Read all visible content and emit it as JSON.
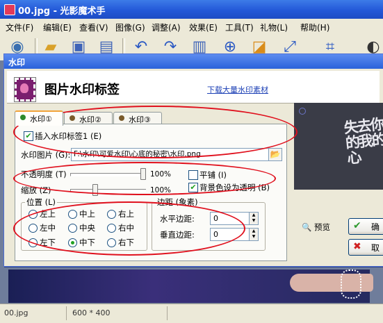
{
  "window": {
    "title": "00.jpg - 光影魔术手"
  },
  "menu": [
    "文件(F)",
    "编辑(E)",
    "查看(V)",
    "图像(G)",
    "调整(A)",
    "效果(E)",
    "工具(T)",
    "礼物(L)",
    "帮助(H)"
  ],
  "toolbar": {
    "icons": [
      "eye-icon",
      "open-folder-icon",
      "save-icon",
      "save-as-icon",
      "undo-icon",
      "redo-icon",
      "compare-icon",
      "zoom-icon",
      "auto-icon",
      "rotate-icon",
      "crop-icon",
      "more-icon"
    ]
  },
  "dialog": {
    "title": "水印",
    "banner_title": "图片水印标签",
    "download_link": "下载大量水印素材",
    "tabs": [
      "水印①",
      "水印②",
      "水印③"
    ],
    "active_tab": 0,
    "tab_colors": [
      "#2d8a2d",
      "#7a5a2a",
      "#7a5a2a"
    ],
    "insert_label": "插入水印标签1 (E)",
    "insert_checked": true,
    "image_label": "水印图片 (G):",
    "image_path": "F:\\水印\\可爱水印\\心底的秘密\\水印.png",
    "opacity_label": "不透明度 (T)",
    "opacity_value": "100%",
    "opacity_level": 1.0,
    "scale_label": "缩放 (Z)",
    "scale_value": "100%",
    "scale_level": 0.36,
    "tile_label": "平铺 (I)",
    "tile_checked": false,
    "transparent_label": "背景色设为透明 (B)",
    "transparent_checked": true,
    "position_label": "位置 (L)",
    "positions": [
      "左上",
      "中上",
      "右上",
      "左中",
      "中央",
      "右中",
      "左下",
      "中下",
      "右下"
    ],
    "position_selected": 7,
    "margin_label": "边距 (象素)",
    "h_margin_label": "水平边距:",
    "h_margin_value": "0",
    "v_margin_label": "垂直边距:",
    "v_margin_value": "0",
    "preview_label": "预览",
    "preview_text": "失去你的我的心",
    "ok_label": "确",
    "cancel_label": "取"
  },
  "status": {
    "file": "00.jpg",
    "size": "600 * 400"
  },
  "colors": {
    "annotation": "#e0101d",
    "titlebar": "#2358d8",
    "link": "#1b3fb5"
  }
}
